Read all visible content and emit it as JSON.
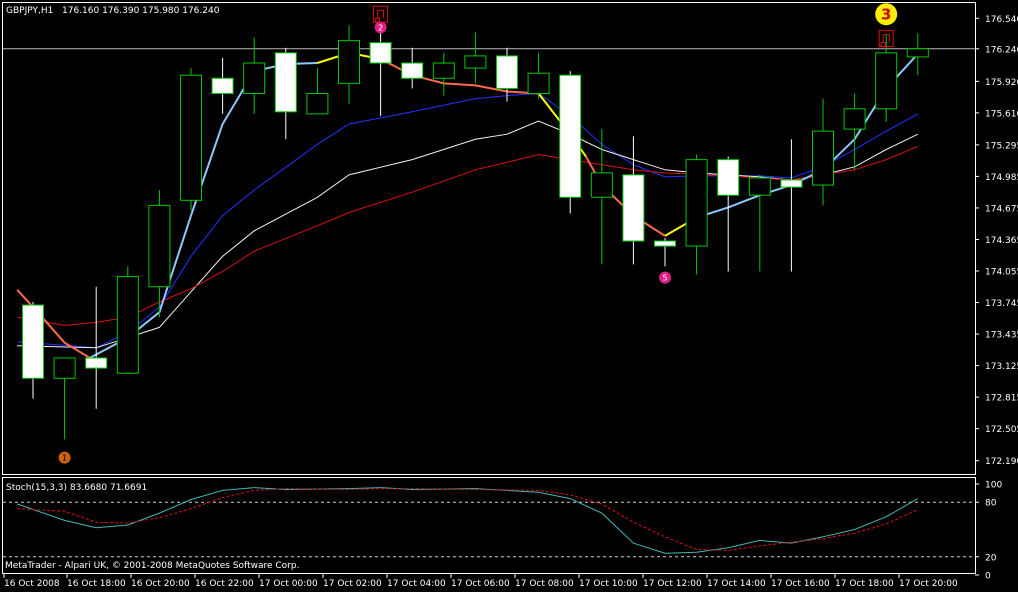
{
  "header": {
    "symbol": "GBPJPY,H1",
    "quote": "176.160 176.390 175.980 176.240"
  },
  "footer": {
    "copyright": "MetaTrader - Alpari UK, © 2001-2008 MetaQuotes Software Corp."
  },
  "colors": {
    "background": "#000000",
    "frame": "#ffffff",
    "bull_candle_outline": "#00c800",
    "bear_candle_fill": "#ffffff",
    "ma_blue": "#2233ff",
    "ma_white": "#f2f2f2",
    "ma_red": "#dd1111",
    "ma_fast_up": "#8fc8ff",
    "ma_fast_flat": "#ffff00",
    "ma_fast_down": "#ff6a4d",
    "stoch_main": "#3fb7b7",
    "stoch_signal": "#dd1111",
    "marker_badge": "#dd1f8a",
    "marker_badge_3": "#ffee00",
    "marker_arrow_box": "#dd1111",
    "marker_dot_1": "#d06010"
  },
  "chart_data": [
    {
      "type": "candlestick",
      "title": "GBPJPY,H1",
      "ylim": [
        172.19,
        176.7
      ],
      "y_ticks": [
        "176.540",
        "176.240",
        "175.920",
        "175.610",
        "175.295",
        "174.985",
        "174.675",
        "174.365",
        "174.055",
        "173.745",
        "173.435",
        "173.125",
        "172.815",
        "172.505",
        "172.190"
      ],
      "x_ticks": [
        "16 Oct 2008",
        "16 Oct 18:00",
        "16 Oct 20:00",
        "16 Oct 22:00",
        "17 Oct 00:00",
        "17 Oct 02:00",
        "17 Oct 04:00",
        "17 Oct 06:00",
        "17 Oct 08:00",
        "17 Oct 10:00",
        "17 Oct 12:00",
        "17 Oct 14:00",
        "17 Oct 16:00",
        "17 Oct 18:00",
        "17 Oct 20:00"
      ],
      "current_price": 176.24,
      "candles": [
        {
          "o": 173.72,
          "h": 173.75,
          "l": 172.8,
          "c": 173.0
        },
        {
          "o": 173.0,
          "h": 173.2,
          "l": 172.4,
          "c": 173.2
        },
        {
          "o": 173.2,
          "h": 173.9,
          "l": 172.7,
          "c": 173.1
        },
        {
          "o": 173.05,
          "h": 174.1,
          "l": 173.05,
          "c": 174.0
        },
        {
          "o": 173.9,
          "h": 174.85,
          "l": 173.6,
          "c": 174.7
        },
        {
          "o": 174.75,
          "h": 176.05,
          "l": 174.65,
          "c": 175.98
        },
        {
          "o": 175.95,
          "h": 176.15,
          "l": 175.6,
          "c": 175.8
        },
        {
          "o": 175.8,
          "h": 176.35,
          "l": 175.6,
          "c": 176.1
        },
        {
          "o": 176.2,
          "h": 176.25,
          "l": 175.35,
          "c": 175.62
        },
        {
          "o": 175.6,
          "h": 176.05,
          "l": 175.6,
          "c": 175.8
        },
        {
          "o": 175.9,
          "h": 176.47,
          "l": 175.7,
          "c": 176.32
        },
        {
          "o": 176.3,
          "h": 176.48,
          "l": 175.58,
          "c": 176.1
        },
        {
          "o": 176.1,
          "h": 176.25,
          "l": 175.85,
          "c": 175.95
        },
        {
          "o": 175.95,
          "h": 176.2,
          "l": 175.78,
          "c": 176.1
        },
        {
          "o": 176.05,
          "h": 176.4,
          "l": 175.9,
          "c": 176.17
        },
        {
          "o": 176.17,
          "h": 176.25,
          "l": 175.72,
          "c": 175.85
        },
        {
          "o": 175.8,
          "h": 176.2,
          "l": 175.75,
          "c": 176.0
        },
        {
          "o": 175.98,
          "h": 176.02,
          "l": 174.62,
          "c": 174.78
        },
        {
          "o": 174.78,
          "h": 175.45,
          "l": 174.12,
          "c": 175.02
        },
        {
          "o": 175.0,
          "h": 175.38,
          "l": 174.12,
          "c": 174.35
        },
        {
          "o": 174.35,
          "h": 174.38,
          "l": 174.1,
          "c": 174.3
        },
        {
          "o": 174.3,
          "h": 175.2,
          "l": 174.02,
          "c": 175.15
        },
        {
          "o": 175.15,
          "h": 175.18,
          "l": 174.05,
          "c": 174.8
        },
        {
          "o": 174.8,
          "h": 175.0,
          "l": 174.05,
          "c": 174.97
        },
        {
          "o": 174.95,
          "h": 175.35,
          "l": 174.05,
          "c": 174.88
        },
        {
          "o": 174.9,
          "h": 175.75,
          "l": 174.7,
          "c": 175.43
        },
        {
          "o": 175.45,
          "h": 175.8,
          "l": 175.05,
          "c": 175.65
        },
        {
          "o": 175.65,
          "h": 176.38,
          "l": 175.52,
          "c": 176.2
        },
        {
          "o": 176.16,
          "h": 176.39,
          "l": 175.98,
          "c": 176.24
        }
      ],
      "moving_averages": [
        {
          "color": "#2233ff",
          "points": [
            [
              -0.5,
              173.36
            ],
            [
              2,
              173.3
            ],
            [
              3,
              173.45
            ],
            [
              4,
              173.7
            ],
            [
              5,
              174.2
            ],
            [
              6,
              174.6
            ],
            [
              7,
              174.85
            ],
            [
              9,
              175.3
            ],
            [
              10,
              175.5
            ],
            [
              12,
              175.62
            ],
            [
              14,
              175.75
            ],
            [
              15,
              175.78
            ],
            [
              16,
              175.8
            ],
            [
              17,
              175.58
            ],
            [
              18,
              175.3
            ],
            [
              19,
              175.1
            ],
            [
              20,
              174.98
            ],
            [
              21,
              174.99
            ],
            [
              23,
              174.99
            ],
            [
              24,
              174.97
            ],
            [
              25,
              175.08
            ],
            [
              26,
              175.25
            ],
            [
              27,
              175.43
            ],
            [
              28,
              175.6
            ]
          ]
        },
        {
          "color": "#f2f2f2",
          "points": [
            [
              -0.5,
              173.32
            ],
            [
              2,
              173.3
            ],
            [
              4,
              173.5
            ],
            [
              5,
              173.85
            ],
            [
              6,
              174.2
            ],
            [
              7,
              174.45
            ],
            [
              9,
              174.78
            ],
            [
              10,
              175.0
            ],
            [
              12,
              175.15
            ],
            [
              14,
              175.35
            ],
            [
              15,
              175.4
            ],
            [
              16,
              175.53
            ],
            [
              17,
              175.4
            ],
            [
              18,
              175.25
            ],
            [
              19,
              175.15
            ],
            [
              20,
              175.05
            ],
            [
              21,
              175.02
            ],
            [
              23,
              174.98
            ],
            [
              24,
              174.95
            ],
            [
              25,
              175.0
            ],
            [
              26,
              175.08
            ],
            [
              27,
              175.25
            ],
            [
              28,
              175.4
            ]
          ]
        },
        {
          "color": "#dd1111",
          "points": [
            [
              -0.5,
              173.6
            ],
            [
              1,
              173.52
            ],
            [
              2,
              173.55
            ],
            [
              3,
              173.6
            ],
            [
              4,
              173.75
            ],
            [
              5,
              173.88
            ],
            [
              6,
              174.05
            ],
            [
              7,
              174.25
            ],
            [
              9,
              174.5
            ],
            [
              10,
              174.63
            ],
            [
              12,
              174.83
            ],
            [
              14,
              175.05
            ],
            [
              16,
              175.2
            ],
            [
              17,
              175.15
            ],
            [
              18,
              175.1
            ],
            [
              19,
              175.05
            ],
            [
              20,
              175.02
            ],
            [
              22,
              174.99
            ],
            [
              24,
              174.95
            ],
            [
              25,
              175.0
            ],
            [
              26,
              175.05
            ],
            [
              27,
              175.15
            ],
            [
              28,
              175.28
            ]
          ]
        },
        {
          "color": "#ff6a4d",
          "points": [
            [
              -0.5,
              173.87
            ],
            [
              0,
              173.7
            ],
            [
              1,
              173.35
            ],
            [
              1.8,
              173.2
            ]
          ]
        },
        {
          "color": "#8fc8ff",
          "points": [
            [
              1.8,
              173.2
            ],
            [
              3,
              173.4
            ],
            [
              4,
              173.65
            ],
            [
              5,
              174.6
            ],
            [
              6,
              175.5
            ],
            [
              7,
              176.02
            ],
            [
              8,
              176.09
            ],
            [
              9,
              176.1
            ]
          ]
        },
        {
          "color": "#ffff00",
          "points": [
            [
              9,
              176.1
            ],
            [
              10,
              176.2
            ],
            [
              11,
              176.14
            ]
          ]
        },
        {
          "color": "#ff6a4d",
          "points": [
            [
              11,
              176.14
            ],
            [
              12,
              175.98
            ],
            [
              13,
              175.9
            ],
            [
              14,
              175.88
            ],
            [
              15,
              175.82
            ],
            [
              16,
              175.8
            ]
          ]
        },
        {
          "color": "#ffff00",
          "points": [
            [
              16,
              175.8
            ],
            [
              17,
              175.4
            ],
            [
              17.5,
              175.18
            ]
          ]
        },
        {
          "color": "#ff6a4d",
          "points": [
            [
              17.5,
              175.18
            ],
            [
              18,
              174.9
            ],
            [
              19,
              174.6
            ],
            [
              20,
              174.4
            ]
          ]
        },
        {
          "color": "#ffff00",
          "points": [
            [
              20,
              174.4
            ],
            [
              21,
              174.58
            ]
          ]
        },
        {
          "color": "#8fc8ff",
          "points": [
            [
              21,
              174.58
            ],
            [
              22,
              174.68
            ],
            [
              23,
              174.8
            ],
            [
              24,
              174.9
            ],
            [
              25,
              175.05
            ],
            [
              26,
              175.35
            ],
            [
              27,
              175.85
            ],
            [
              28,
              176.19
            ]
          ]
        }
      ],
      "markers": [
        {
          "label": "1",
          "kind": "dot",
          "candle": 1,
          "price": 172.22
        },
        {
          "label": "2",
          "kind": "badge",
          "candle": 11,
          "price": 176.45
        },
        {
          "label": "5",
          "kind": "badge",
          "candle": 20,
          "price": 173.99
        },
        {
          "label": "3",
          "kind": "badge-large",
          "candle": 27,
          "price": 176.58
        },
        {
          "label": "",
          "kind": "arrow-box",
          "candle": 11,
          "price": 176.57
        },
        {
          "label": "",
          "kind": "arrow-box",
          "candle": 27,
          "price": 176.33
        }
      ]
    },
    {
      "type": "line",
      "title": "Stoch(15,3,3) 83.6680 71.6691",
      "ylim": [
        0,
        100
      ],
      "y_ticks": [
        "100",
        "80",
        "20",
        "0"
      ],
      "levels": [
        80,
        20
      ],
      "series": [
        {
          "name": "main",
          "values": [
            [
              -0.5,
              78
            ],
            [
              1,
              60
            ],
            [
              2,
              52
            ],
            [
              3,
              55
            ],
            [
              4,
              68
            ],
            [
              5,
              83
            ],
            [
              6,
              93
            ],
            [
              7,
              96
            ],
            [
              8,
              94
            ],
            [
              10,
              95
            ],
            [
              11,
              96
            ],
            [
              12,
              94
            ],
            [
              14,
              95
            ],
            [
              16,
              91
            ],
            [
              17,
              84
            ],
            [
              18,
              68
            ],
            [
              19,
              35
            ],
            [
              20,
              24
            ],
            [
              21,
              25
            ],
            [
              22,
              30
            ],
            [
              23,
              38
            ],
            [
              24,
              35
            ],
            [
              25,
              42
            ],
            [
              26,
              50
            ],
            [
              27,
              64
            ],
            [
              28,
              84
            ]
          ]
        },
        {
          "name": "signal",
          "values": [
            [
              -0.5,
              73
            ],
            [
              1,
              70
            ],
            [
              2,
              58
            ],
            [
              3,
              57
            ],
            [
              4,
              63
            ],
            [
              5,
              73
            ],
            [
              6,
              85
            ],
            [
              7,
              93
            ],
            [
              8,
              95
            ],
            [
              10,
              94
            ],
            [
              11,
              95
            ],
            [
              12,
              95
            ],
            [
              14,
              94
            ],
            [
              16,
              93
            ],
            [
              17,
              88
            ],
            [
              18,
              78
            ],
            [
              19,
              58
            ],
            [
              20,
              42
            ],
            [
              21,
              28
            ],
            [
              22,
              27
            ],
            [
              23,
              32
            ],
            [
              24,
              36
            ],
            [
              25,
              40
            ],
            [
              26,
              46
            ],
            [
              27,
              56
            ],
            [
              28,
              72
            ]
          ]
        }
      ]
    }
  ]
}
